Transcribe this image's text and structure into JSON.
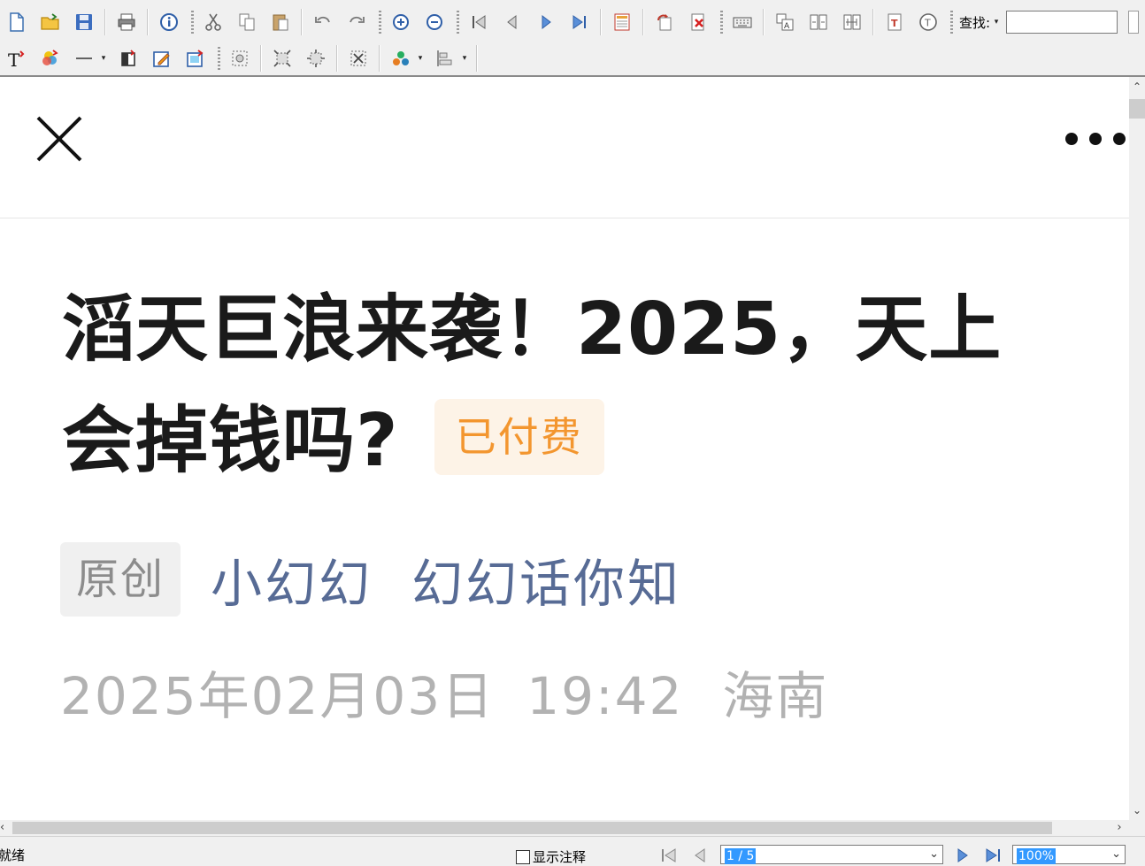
{
  "toolbar": {
    "find_label": "查找:",
    "find_value": ""
  },
  "article": {
    "title": "滔天巨浪来袭！2025，天上会掉钱吗?",
    "paid_badge": "已付费",
    "original_tag": "原创",
    "author": "小幻幻",
    "account": "幻幻话你知",
    "date": "2025年02月03日",
    "time": "19:42",
    "location": "海南"
  },
  "statusbar": {
    "status": "就绪",
    "show_notes_label": "显示注释",
    "page": "1 / 5",
    "zoom": "100%"
  },
  "colors": {
    "accent_link": "#576b95",
    "paid_text": "#f3962f",
    "paid_bg": "#fdf3e7",
    "selection": "#3399ff"
  }
}
